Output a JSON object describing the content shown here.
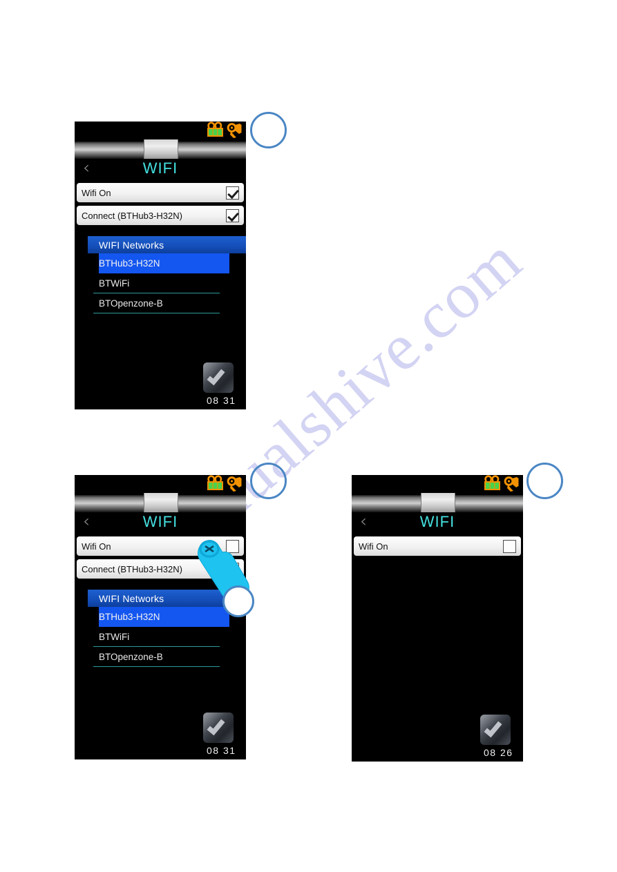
{
  "watermark": {
    "text": "manualshive.com"
  },
  "colors": {
    "accent_title": "#45e0e0",
    "selected_blue": "#1456f0",
    "header_blue": "#1550bb",
    "separator_teal": "#2e9a9a",
    "callout_blue": "#4a86c4",
    "hand_cyan": "#1ec3f0",
    "battery_green": "#3cc23c",
    "robot_orange": "#f39200"
  },
  "panels": [
    {
      "id": "panel-1",
      "statusbar": {
        "icons": [
          {
            "name": "battery-icon",
            "color": "#3cc23c"
          },
          {
            "name": "robot-arm-icon",
            "color": "#f39200"
          }
        ]
      },
      "header": {
        "back_label": "‹",
        "title": "WIFI"
      },
      "rows": [
        {
          "name": "wifi-on-row",
          "label": "Wifi On",
          "checked": true
        },
        {
          "name": "connect-row",
          "label": "Connect (BTHub3-H32N)",
          "checked": true
        }
      ],
      "networks": {
        "header": "WIFI Networks",
        "items": [
          {
            "label": "BTHub3-H32N",
            "selected": true
          },
          {
            "label": "BTWiFi",
            "selected": false
          },
          {
            "label": "BTOpenzone-B",
            "selected": false
          }
        ]
      },
      "footer": {
        "badge": "check-badge-icon",
        "clock": "08 31"
      }
    },
    {
      "id": "panel-2",
      "statusbar": {
        "icons": [
          {
            "name": "battery-icon",
            "color": "#3cc23c"
          },
          {
            "name": "robot-arm-icon",
            "color": "#f39200"
          }
        ]
      },
      "header": {
        "back_label": "‹",
        "title": "WIFI"
      },
      "rows": [
        {
          "name": "wifi-on-row",
          "label": "Wifi On",
          "checked": false
        },
        {
          "name": "connect-row",
          "label": "Connect (BTHub3-H32N)",
          "checked": true
        }
      ],
      "networks": {
        "header": "WIFI Networks",
        "items": [
          {
            "label": "BTHub3-H32N",
            "selected": true
          },
          {
            "label": "BTWiFi",
            "selected": false
          },
          {
            "label": "BTOpenzone-B",
            "selected": false
          }
        ]
      },
      "footer": {
        "badge": "check-badge-icon",
        "clock": "08 31"
      },
      "gesture": {
        "name": "tap-hand-cursor",
        "target": "wifi-on-checkbox"
      }
    },
    {
      "id": "panel-3",
      "statusbar": {
        "icons": [
          {
            "name": "battery-icon",
            "color": "#3cc23c"
          },
          {
            "name": "robot-arm-icon",
            "color": "#f39200"
          }
        ]
      },
      "header": {
        "back_label": "‹",
        "title": "WIFI"
      },
      "rows": [
        {
          "name": "wifi-on-row",
          "label": "Wifi On",
          "checked": false
        }
      ],
      "footer": {
        "badge": "check-badge-icon",
        "clock": "08 26"
      }
    }
  ],
  "callouts": [
    {
      "name": "callout-marker-1",
      "label": ""
    },
    {
      "name": "callout-marker-2",
      "label": ""
    },
    {
      "name": "callout-marker-3",
      "label": ""
    }
  ]
}
